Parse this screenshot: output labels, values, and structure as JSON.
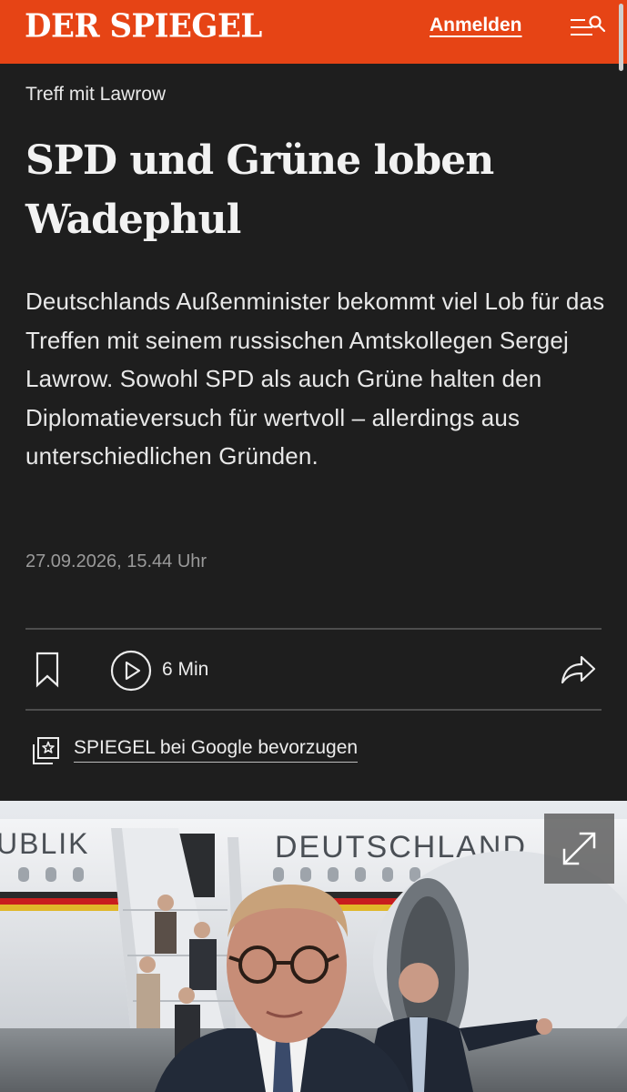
{
  "header": {
    "logo": "DER SPIEGEL",
    "login_label": "Anmelden",
    "menu_icon": "menu-icon",
    "search_icon": "search-icon",
    "bg_color": "#e64415"
  },
  "article": {
    "kicker": "Treff mit Lawrow",
    "title": "SPD und Grüne loben Wadephul",
    "teaser": "Deutschlands Außenminister bekommt viel Lob für das Treffen mit seinem russischen Amtskollegen Sergej Lawrow. Sowohl SPD als auch Grüne halten den Diplomatieversuch für wertvoll – allerdings aus unterschiedlichen Gründen.",
    "date": "27.09.2026, 15.44 Uhr"
  },
  "actions": {
    "bookmark_icon": "bookmark-icon",
    "play_icon": "play-icon",
    "duration": "6 Min",
    "share_icon": "share-icon"
  },
  "google": {
    "icon": "google-star-icon",
    "label": "SPIEGEL bei Google bevorzugen"
  },
  "hero": {
    "expand_icon": "expand-icon",
    "plane_lettering": "DEUTSCHLAND",
    "plane_lettering_left": "UBLIK"
  },
  "colors": {
    "background": "#1e1e1e",
    "text": "#f2f2f2",
    "muted": "#9a9a9a",
    "divider": "#4d4d4d"
  }
}
